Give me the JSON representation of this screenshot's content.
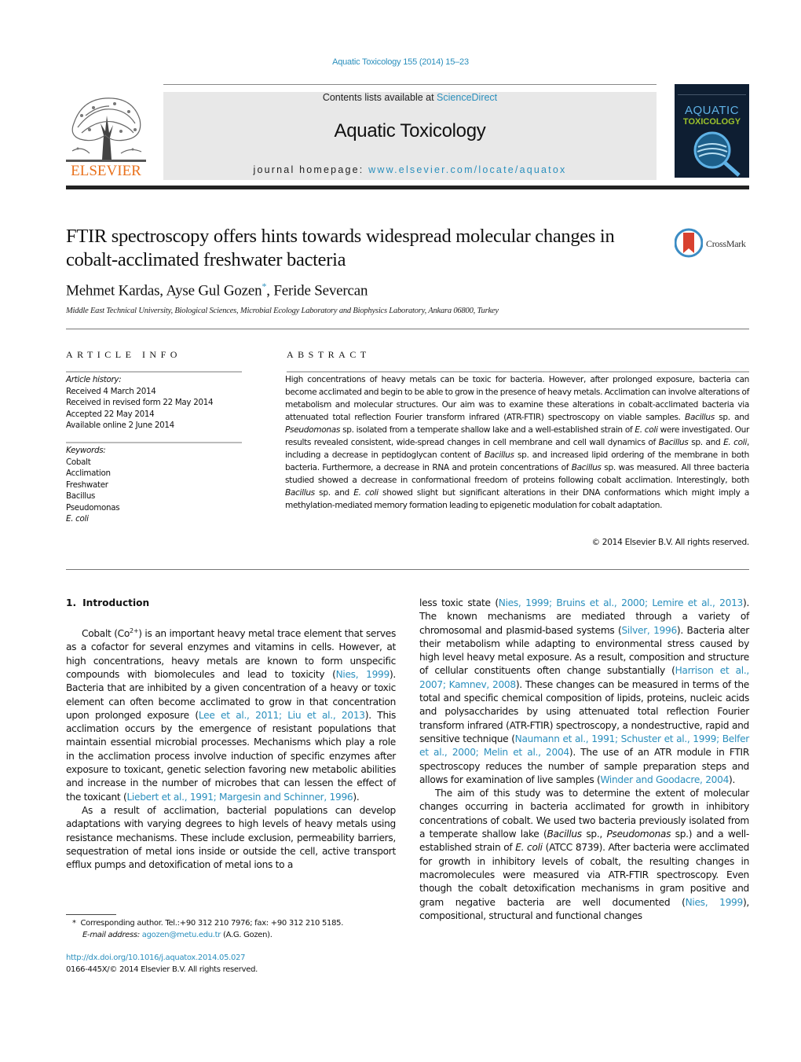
{
  "header": {
    "journal_ref": "Aquatic Toxicology 155 (2014) 15–23",
    "contents_prefix": "Contents lists available at ",
    "contents_link": "ScienceDirect",
    "journal_title": "Aquatic Toxicology",
    "homepage_prefix": "journal homepage: ",
    "homepage_link": "www.elsevier.com/locate/aquatox",
    "publisher_logo_text": "ELSEVIER",
    "cover": {
      "line1": "AQUATIC",
      "line2": "TOXICOLOGY",
      "colors": {
        "background": "#0e1e32",
        "aquatic": "#5fb2e6",
        "toxicology": "#9cc22b"
      }
    },
    "brand_color": "#e9711c",
    "link_color": "#2a8fbd"
  },
  "article": {
    "title": "FTIR spectroscopy offers hints towards widespread molecular changes in cobalt-acclimated freshwater bacteria",
    "crossmark_label": "CrossMark",
    "authors": [
      {
        "name": "Mehmet Kardas",
        "sep": ", "
      },
      {
        "name": "Ayse Gul Gozen",
        "mark": "*",
        "sep": ", "
      },
      {
        "name": "Feride Severcan",
        "sep": ""
      }
    ],
    "affiliation": "Middle East Technical University, Biological Sciences, Microbial Ecology Laboratory and Biophysics Laboratory, Ankara 06800, Turkey"
  },
  "article_info": {
    "heading": "ARTICLE INFO",
    "history_label": "Article history:",
    "history": [
      "Received 4 March 2014",
      "Received in revised form 22 May 2014",
      "Accepted 22 May 2014",
      "Available online 2 June 2014"
    ],
    "keywords_label": "Keywords:",
    "keywords": [
      "Cobalt",
      "Acclimation",
      "Freshwater",
      "Bacillus",
      "Pseudomonas",
      "E. coli"
    ]
  },
  "abstract": {
    "heading": "ABSTRACT",
    "segments": [
      {
        "t": "High concentrations of heavy metals can be toxic for bacteria. However, after prolonged exposure, bacteria can become acclimated and begin to be able to grow in the presence of heavy metals. Acclimation can involve alterations of metabolism and molecular structures. Our aim was to examine these alterations in cobalt-acclimated bacteria via attenuated total reflection Fourier transform infrared (ATR-FTIR) spectroscopy on viable samples. "
      },
      {
        "t": "Bacillus",
        "i": true
      },
      {
        "t": " sp. and "
      },
      {
        "t": "Pseudomonas",
        "i": true
      },
      {
        "t": " sp. isolated from a temperate shallow lake and a well-established strain of "
      },
      {
        "t": "E. coli",
        "i": true
      },
      {
        "t": " were investigated. Our results revealed consistent, wide-spread changes in cell membrane and cell wall dynamics of "
      },
      {
        "t": "Bacillus",
        "i": true
      },
      {
        "t": " sp. and "
      },
      {
        "t": "E. coli",
        "i": true
      },
      {
        "t": ", including a decrease in peptidoglycan content of "
      },
      {
        "t": "Bacillus",
        "i": true
      },
      {
        "t": " sp. and increased lipid ordering of the membrane in both bacteria. Furthermore, a decrease in RNA and protein concentrations of "
      },
      {
        "t": "Bacillus",
        "i": true
      },
      {
        "t": " sp. was measured. All three bacteria studied showed a decrease in conformational freedom of proteins following cobalt acclimation. Interestingly, both "
      },
      {
        "t": "Bacillus",
        "i": true
      },
      {
        "t": " sp. and "
      },
      {
        "t": "E. coli",
        "i": true
      },
      {
        "t": " showed slight but significant alterations in their DNA conformations which might imply a methylation-mediated memory formation leading to epigenetic modulation for cobalt adaptation."
      }
    ],
    "copyright": "© 2014 Elsevier B.V. All rights reserved."
  },
  "body": {
    "section_number": "1.",
    "section_title": "Introduction",
    "left_paragraphs": [
      [
        {
          "t": "Cobalt (Co"
        },
        {
          "t": "2+",
          "sup": true
        },
        {
          "t": ") is an important heavy metal trace element that serves as a cofactor for several enzymes and vitamins in cells. However, at high concentrations, heavy metals are known to form unspecific compounds with biomolecules and lead to toxicity ("
        },
        {
          "t": "Nies, 1999",
          "link": true
        },
        {
          "t": "). Bacteria that are inhibited by a given concentration of a heavy or toxic element can often become acclimated to grow in that concentration upon prolonged exposure ("
        },
        {
          "t": "Lee et al., 2011; Liu et al., 2013",
          "link": true
        },
        {
          "t": "). This acclimation occurs by the emergence of resistant populations that maintain essential microbial processes. Mechanisms which play a role in the acclimation process involve induction of specific enzymes after exposure to toxicant, genetic selection favoring new metabolic abilities and increase in the number of microbes that can lessen the effect of the toxicant ("
        },
        {
          "t": "Liebert et al., 1991; Margesin and Schinner, 1996",
          "link": true
        },
        {
          "t": ")."
        }
      ],
      [
        {
          "t": "As a result of acclimation, bacterial populations can develop adaptations with varying degrees to high levels of heavy metals using resistance mechanisms. These include exclusion, permeability barriers, sequestration of metal ions inside or outside the cell, active transport efflux pumps and detoxification of metal ions to a"
        }
      ]
    ],
    "right_paragraphs": [
      [
        {
          "t": "less toxic state ("
        },
        {
          "t": "Nies, 1999; Bruins et al., 2000; Lemire et al., 2013",
          "link": true
        },
        {
          "t": "). The known mechanisms are mediated through a variety of chromosomal and plasmid-based systems ("
        },
        {
          "t": "Silver, 1996",
          "link": true
        },
        {
          "t": "). Bacteria alter their metabolism while adapting to environmental stress caused by high level heavy metal exposure. As a result, composition and structure of cellular constituents often change substantially ("
        },
        {
          "t": "Harrison et al., 2007; Kamnev, 2008",
          "link": true
        },
        {
          "t": "). These changes can be measured in terms of the total and specific chemical composition of lipids, proteins, nucleic acids and polysaccharides by using attenuated total reflection Fourier transform infrared (ATR-FTIR) spectroscopy, a nondestructive, rapid and sensitive technique ("
        },
        {
          "t": "Naumann et al., 1991; Schuster et al., 1999; Belfer et al., 2000; Melin et al., 2004",
          "link": true
        },
        {
          "t": "). The use of an ATR module in FTIR spectroscopy reduces the number of sample preparation steps and allows for examination of live samples ("
        },
        {
          "t": "Winder and Goodacre, 2004",
          "link": true
        },
        {
          "t": ")."
        }
      ],
      [
        {
          "t": "The aim of this study was to determine the extent of molecular changes occurring in bacteria acclimated for growth in inhibitory concentrations of cobalt. We used two bacteria previously isolated from a temperate shallow lake ("
        },
        {
          "t": "Bacillus",
          "i": true
        },
        {
          "t": " sp., "
        },
        {
          "t": "Pseudomonas",
          "i": true
        },
        {
          "t": " sp.) and a well- established strain of "
        },
        {
          "t": "E. coli",
          "i": true
        },
        {
          "t": " (ATCC 8739). After bacteria were acclimated for growth in inhibitory levels of cobalt, the resulting changes in macromolecules were measured via ATR-FTIR spectroscopy. Even though the cobalt detoxification mechanisms in gram positive and gram negative bacteria are well documented ("
        },
        {
          "t": "Nies, 1999",
          "link": true
        },
        {
          "t": "), compositional, structural and functional changes"
        }
      ]
    ]
  },
  "footnotes": {
    "mark": "*",
    "corresponding": "Corresponding author. Tel.:+90 312 210 7976; fax: +90 312 210 5185.",
    "email_label": "E-mail address: ",
    "email": "agozen@metu.edu.tr",
    "email_suffix": " (A.G. Gozen).",
    "doi": "http://dx.doi.org/10.1016/j.aquatox.2014.05.027",
    "issn_line": "0166-445X/© 2014 Elsevier B.V. All rights reserved."
  }
}
